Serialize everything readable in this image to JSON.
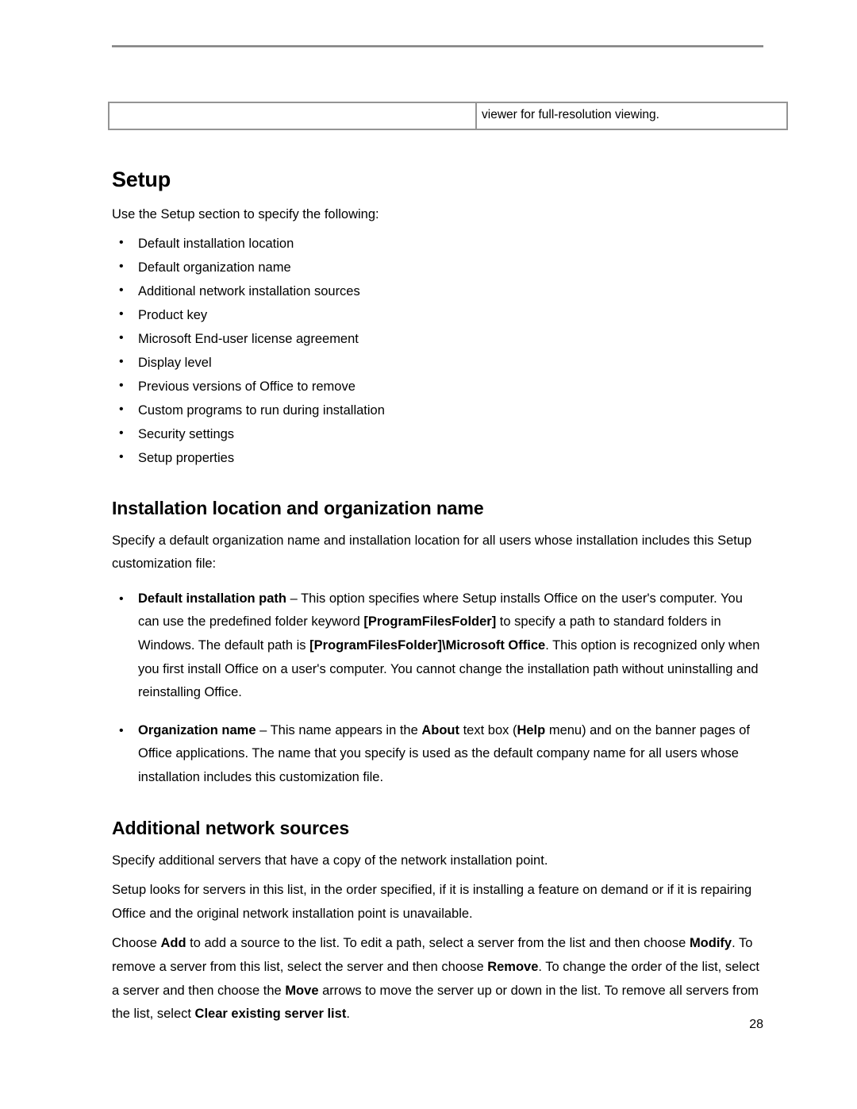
{
  "page": {
    "number": "28",
    "header_rule": true
  },
  "carry_table": {
    "rows": [
      {
        "left": "",
        "right": "viewer for full-resolution viewing."
      }
    ]
  },
  "sections": [
    {
      "id": "setup",
      "heading": "Setup",
      "intro": "Use the Setup section to specify the following:",
      "bullets": [
        "Default installation location",
        "Default organization name",
        "Additional network installation sources",
        "Product key",
        "Microsoft End-user license agreement",
        "Display level",
        "Previous versions of Office to remove",
        "Custom programs to run during installation",
        "Security settings",
        "Setup properties"
      ]
    },
    {
      "id": "installation-location",
      "heading": "Installation location and organization name",
      "intro": "Specify a default organization name and installation location for all users whose installation includes this Setup customization file:",
      "items": [
        {
          "term": "Default installation path",
          "body_1": " – This option specifies where Setup installs Office on the user's computer. You can use the predefined folder keyword ",
          "kw_1": "[ProgramFilesFolder]",
          "body_2": " to specify a path to standard folders in Windows. The default path is ",
          "kw_2": "[ProgramFilesFolder]\\Microsoft Office",
          "body_3": ". This option is recognized only when you first install Office on a user's computer. You cannot change the installation path without uninstalling and reinstalling Office."
        },
        {
          "term": "Organization name",
          "body_1": " – This name appears in the ",
          "kw_1": "About",
          "body_2": " text box (",
          "kw_2": "Help",
          "body_3": " menu) and on the banner pages of Office applications. The name that you specify is used as the default company name for all users whose installation includes this customization file."
        }
      ]
    },
    {
      "id": "additional-network-sources",
      "heading": "Additional network sources",
      "para_1": "Specify additional servers that have a copy of the network installation point.",
      "para_2": "Setup looks for servers in this list, in the order specified, if it is installing a feature on demand or if it is repairing Office and the original network installation point is unavailable.",
      "para_3": {
        "t1": "Choose ",
        "b1": "Add",
        "t2": " to add a source to the list. To edit a path, select a server from the list and then choose ",
        "b2": "Modify",
        "t3": ". To remove a server from this list, select the server and then choose ",
        "b3": "Remove",
        "t4": ". To change the order of the list, select a server and then choose the ",
        "b4": "Move",
        "t5": " arrows to move the server up or down in the list. To remove all servers from the list, select ",
        "b5": "Clear existing server list",
        "t6": "."
      }
    }
  ]
}
